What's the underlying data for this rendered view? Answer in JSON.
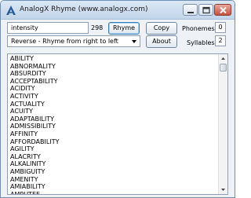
{
  "window": {
    "title": "AnalogX Rhyme (www.analogx.com)",
    "icon": "analogx-app-icon",
    "controls": [
      "minimize-icon",
      "maximize-icon",
      "close-icon"
    ]
  },
  "search": {
    "value": "intensity",
    "result_count": "298"
  },
  "buttons": {
    "rhyme": "Rhyme",
    "copy": "Copy",
    "about": "About"
  },
  "mode": {
    "selected": "Reverse - Rhyme from right to left"
  },
  "stats": {
    "phonemes_label": "Phonemes",
    "phonemes_value": "0",
    "syllables_label": "Syllables",
    "syllables_value": "2"
  },
  "results": [
    "ABILITY",
    "ABNORMALITY",
    "ABSURDITY",
    "ACCEPTABILITY",
    "ACIDITY",
    "ACTIVITY",
    "ACTUALITY",
    "ACUITY",
    "ADAPTABILITY",
    "ADMISSIBILITY",
    "AFFINITY",
    "AFFORDABILITY",
    "AGILITY",
    "ALACRITY",
    "ALKALINITY",
    "AMBIGUITY",
    "AMENITY",
    "AMIABILITY",
    "AMPUTEE"
  ],
  "colors": {
    "window_bg": "#eef2f7",
    "title_bar": "#c3d5ea",
    "close_button": "#c4513f",
    "default_button_focus": "#3c7fb1"
  }
}
